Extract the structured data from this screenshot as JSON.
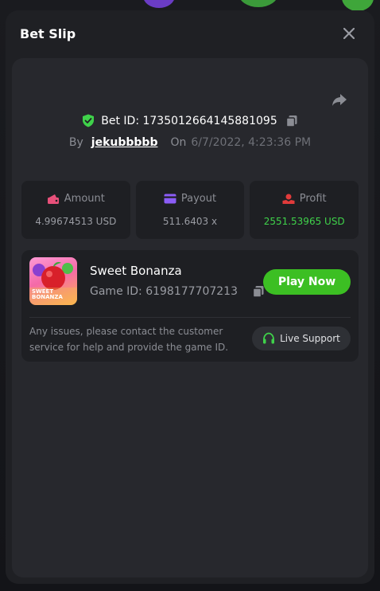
{
  "modal": {
    "title": "Bet Slip"
  },
  "bet": {
    "id_label": "Bet ID: 1735012664145881095",
    "by_label": "By",
    "username": "jekubbbbb",
    "on_label": "On",
    "date": "6/7/2022, 4:23:36 PM"
  },
  "stats": {
    "amount": {
      "label": "Amount",
      "value": "4.99674513 USD"
    },
    "payout": {
      "label": "Payout",
      "value": "511.6403 x"
    },
    "profit": {
      "label": "Profit",
      "value": "2551.53965 USD"
    }
  },
  "game": {
    "name": "Sweet Bonanza",
    "id_label": "Game ID: 6198177707213",
    "thumb_text_line1": "SWEET",
    "thumb_text_line2": "BONANZA",
    "play_label": "Play Now",
    "help_text": "Any issues, please contact the customer service for help and provide the game ID.",
    "support_label": "Live Support"
  },
  "colors": {
    "accent_green": "#3cbf23",
    "profit_green": "#3fd24a",
    "shield_green": "#3fd24a",
    "amount_icon": "#e8507a",
    "payout_icon": "#8b5cf6",
    "profit_icon": "#e23b3b"
  },
  "icons": [
    "close-icon",
    "share-icon",
    "shield-check-icon",
    "copy-icon",
    "wallet-icon",
    "card-icon",
    "profit-icon",
    "headset-icon"
  ]
}
